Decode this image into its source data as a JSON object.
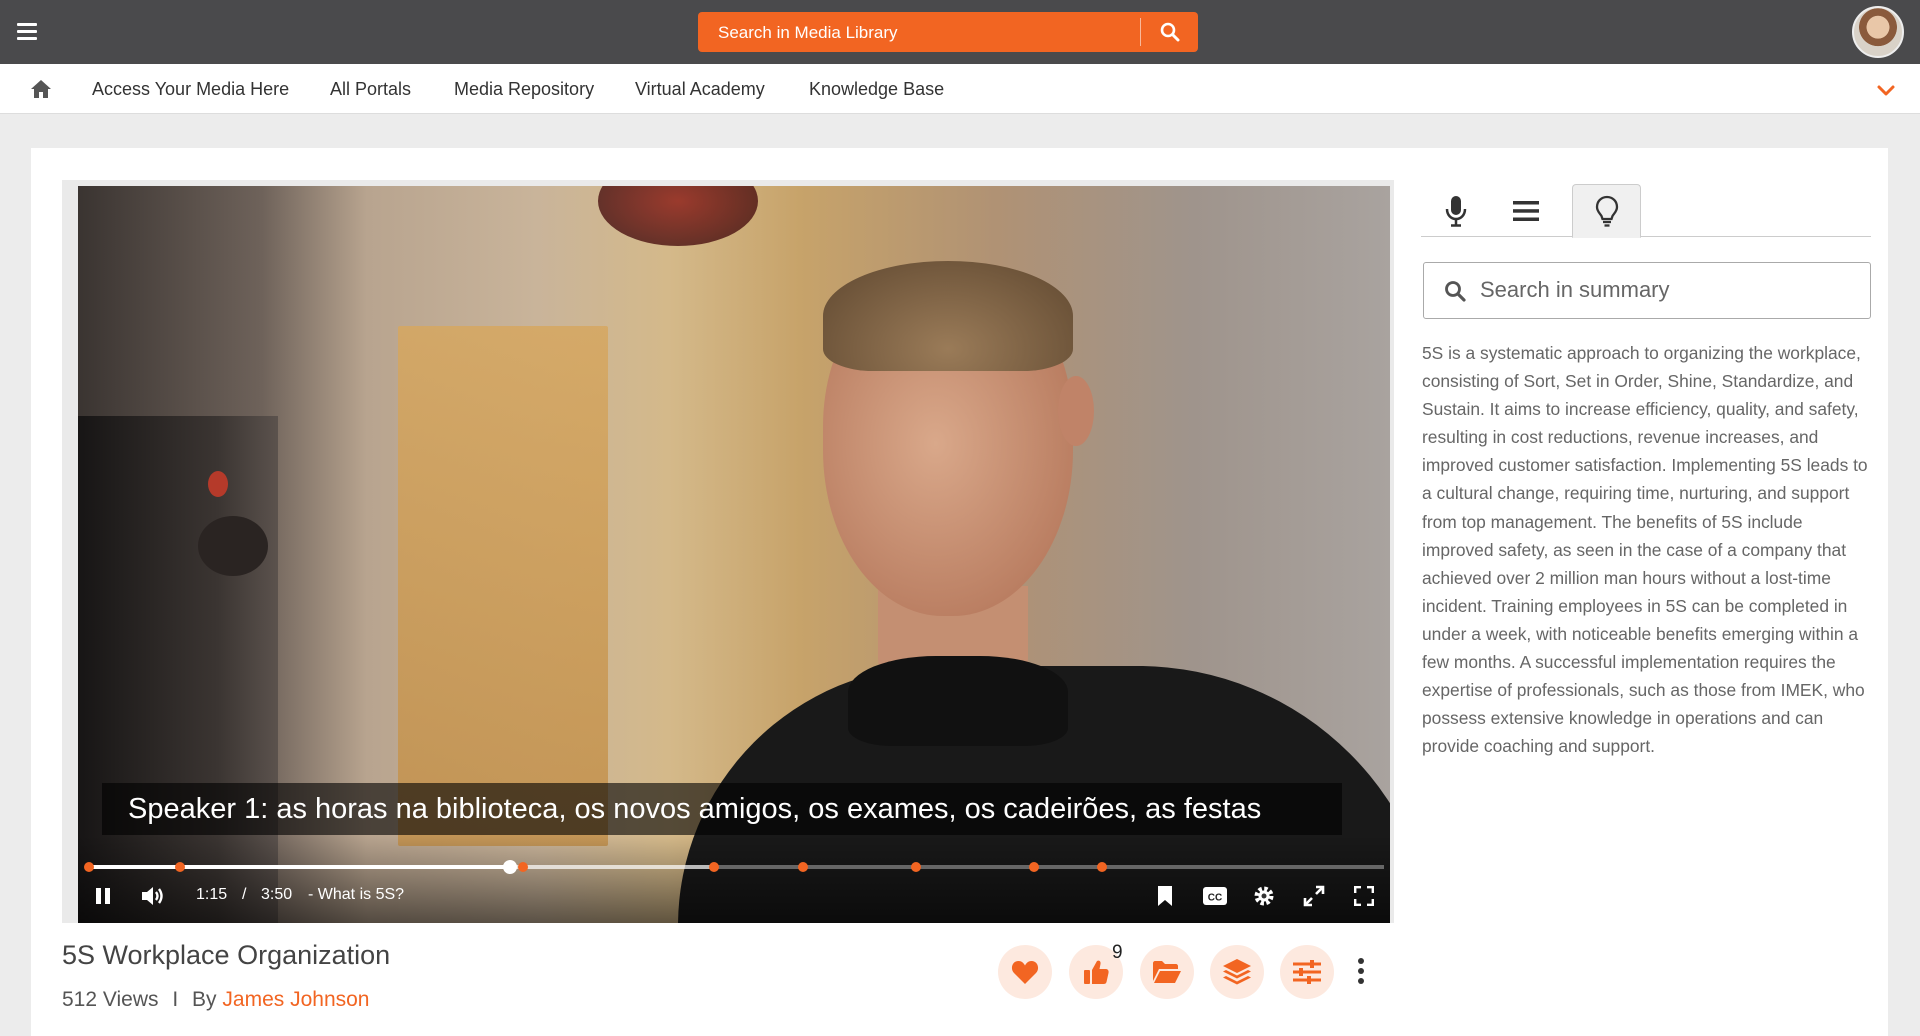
{
  "header": {
    "search_placeholder": "Search in Media Library"
  },
  "nav": {
    "items": [
      {
        "label": "Access Your Media Here"
      },
      {
        "label": "All Portals"
      },
      {
        "label": "Media Repository"
      },
      {
        "label": "Virtual Academy"
      },
      {
        "label": "Knowledge Base"
      }
    ]
  },
  "player": {
    "caption": "Speaker 1: as horas na biblioteca, os novos amigos, os exames, os cadeirões, as festas",
    "current_time": "1:15",
    "separator": "/",
    "duration": "3:50",
    "chapter": "- What is 5S?",
    "progress_fraction": 0.326,
    "accent_color": "#f26522"
  },
  "media": {
    "title": "5S Workplace Organization",
    "views": "512 Views",
    "by_separator": "I",
    "by_label": "By",
    "author": "James Johnson",
    "like_count": "9"
  },
  "side_panel": {
    "tabs": [
      "microphone-icon",
      "list-icon",
      "lightbulb-icon"
    ],
    "active_tab": "lightbulb-icon",
    "search_placeholder": "Search in summary",
    "summary": "5S is a systematic approach to organizing the workplace, consisting of Sort, Set in Order, Shine, Standardize, and Sustain. It aims to increase efficiency, quality, and safety, resulting in cost reductions, revenue increases, and improved customer satisfaction. Implementing 5S leads to a cultural change, requiring time, nurturing, and support from top management. The benefits of 5S include improved safety, as seen in the case of a company that achieved over 2 million man hours without a lost-time incident. Training employees in 5S can be completed in under a week, with noticeable benefits emerging within a few months. A successful implementation requires the expertise of professionals, such as those from IMEK, who possess extensive knowledge in operations and can provide coaching and support."
  }
}
